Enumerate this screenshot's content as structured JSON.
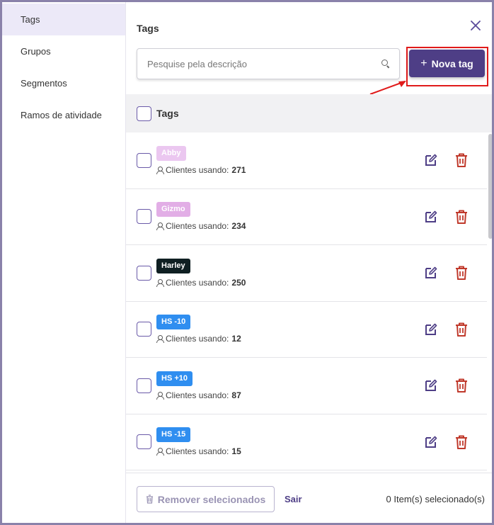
{
  "sidebar": {
    "items": [
      {
        "label": "Tags",
        "active": true
      },
      {
        "label": "Grupos",
        "active": false
      },
      {
        "label": "Segmentos",
        "active": false
      },
      {
        "label": "Ramos de atividade",
        "active": false
      }
    ]
  },
  "panel": {
    "title": "Tags",
    "close_icon": "close-icon"
  },
  "search": {
    "placeholder": "Pesquise pela descrição",
    "value": ""
  },
  "new_tag_button": {
    "label": "Nova tag",
    "plus": "+"
  },
  "list": {
    "header_label": "Tags",
    "usage_label": "Clientes usando:",
    "rows": [
      {
        "tag": "Abby",
        "tag_bg": "#ebc7f0",
        "tag_fg": "#ffffff",
        "count": "271"
      },
      {
        "tag": "Gizmo",
        "tag_bg": "#e2aee6",
        "tag_fg": "#ffffff",
        "count": "234"
      },
      {
        "tag": "Harley",
        "tag_bg": "#0f1f22",
        "tag_fg": "#ffffff",
        "count": "250"
      },
      {
        "tag": "HS -10",
        "tag_bg": "#2f8ef0",
        "tag_fg": "#ffffff",
        "count": "12"
      },
      {
        "tag": "HS +10",
        "tag_bg": "#2f8ef0",
        "tag_fg": "#ffffff",
        "count": "87"
      },
      {
        "tag": "HS -15",
        "tag_bg": "#2f8ef0",
        "tag_fg": "#ffffff",
        "count": "15"
      }
    ]
  },
  "footer": {
    "remove_label": "Remover selecionados",
    "exit_label": "Sair",
    "selected_text": "0 Item(s) selecionado(s)"
  },
  "colors": {
    "accent": "#4e3e86",
    "delete": "#c0392b",
    "highlight": "#e01b1b"
  }
}
